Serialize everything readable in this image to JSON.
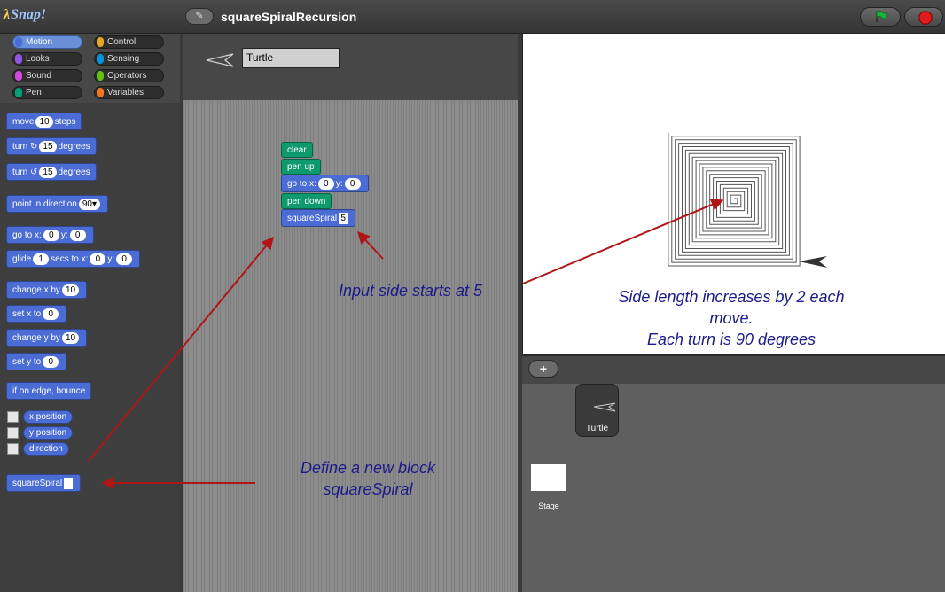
{
  "app": {
    "logo_lambda": "λ",
    "logo_text": "Snap!",
    "project_title": "squareSpiralRecursion",
    "edit_icon": "pencil-icon"
  },
  "categories": [
    {
      "label": "Motion",
      "color": "#4a6cd4",
      "active": true
    },
    {
      "label": "Control",
      "color": "#e6a822"
    },
    {
      "label": "Looks",
      "color": "#8f56e3"
    },
    {
      "label": "Sensing",
      "color": "#0494dc"
    },
    {
      "label": "Sound",
      "color": "#cf4ad9"
    },
    {
      "label": "Operators",
      "color": "#62c213"
    },
    {
      "label": "Pen",
      "color": "#00a178"
    },
    {
      "label": "Variables",
      "color": "#f3761d"
    }
  ],
  "palette": {
    "move": {
      "a": "move",
      "v": "10",
      "b": "steps"
    },
    "turn_cw": {
      "a": "turn",
      "icon": "↻",
      "v": "15",
      "b": "degrees"
    },
    "turn_ccw": {
      "a": "turn",
      "icon": "↺",
      "v": "15",
      "b": "degrees"
    },
    "point": {
      "a": "point in direction",
      "v": "90"
    },
    "goto": {
      "a": "go to x:",
      "x": "0",
      "b": "y:",
      "y": "0"
    },
    "glide": {
      "a": "glide",
      "v": "1",
      "b": "secs to x:",
      "x": "0",
      "c": "y:",
      "y": "0"
    },
    "change_x": {
      "a": "change x by",
      "v": "10"
    },
    "set_x": {
      "a": "set x to",
      "v": "0"
    },
    "change_y": {
      "a": "change y by",
      "v": "10"
    },
    "set_y": {
      "a": "set y to",
      "v": "0"
    },
    "bounce": "if on edge, bounce",
    "reporters": [
      "x position",
      "y position",
      "direction"
    ],
    "custom": "squareSpiral"
  },
  "sprite": {
    "name": "Turtle"
  },
  "script": {
    "clear": "clear",
    "pen_up": "pen up",
    "goto": {
      "a": "go to x:",
      "x": "0",
      "b": "y:",
      "y": "0"
    },
    "pen_down": "pen down",
    "custom": {
      "a": "squareSpiral",
      "v": "5"
    }
  },
  "corral": {
    "add_label": "+",
    "sprite_label": "Turtle",
    "stage_label": "Stage"
  },
  "annotations": {
    "input_side": "Input side starts at 5",
    "side_length_1": "Side length increases by 2 each",
    "side_length_2": "move.",
    "turn": "Each turn is 90  degrees",
    "define_1": "Define a new block",
    "define_2": "squareSpiral"
  },
  "colors": {
    "motion": "#4a6cd4",
    "pen": "#0e9a6c",
    "arrow": "#b01515",
    "annotation": "#1b1b8a"
  }
}
